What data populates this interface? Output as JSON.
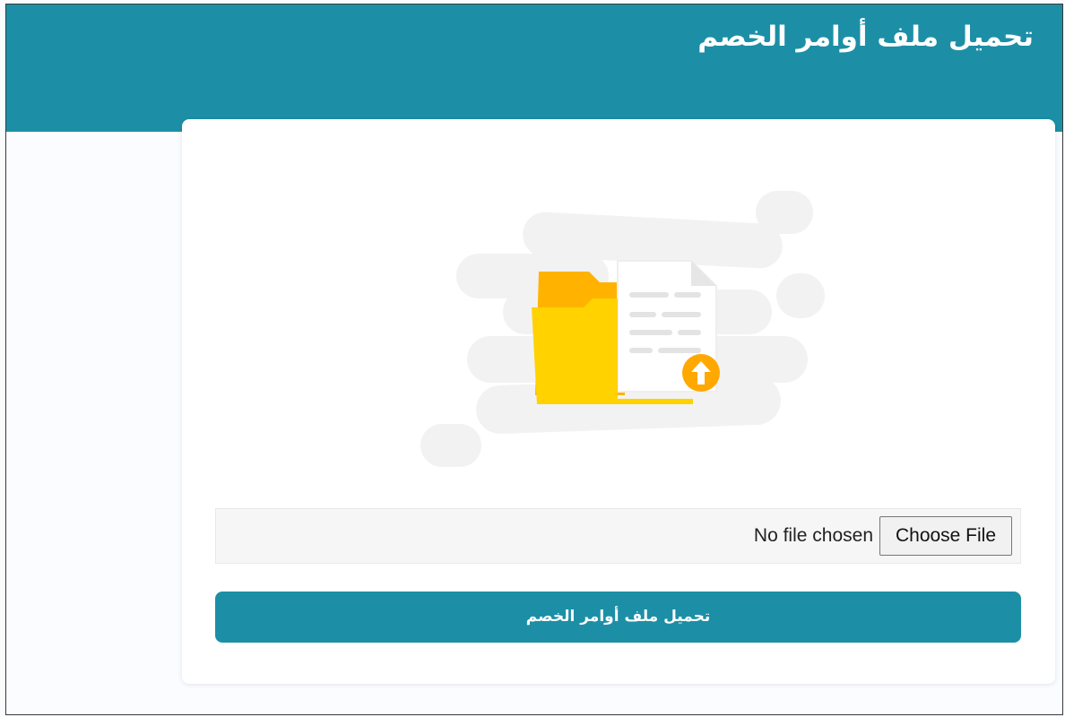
{
  "header": {
    "title": "تحميل ملف أوامر الخصم"
  },
  "upload": {
    "file_status": "No file chosen",
    "choose_label": "Choose File",
    "submit_label": "تحميل ملف أوامر الخصم"
  },
  "icons": {
    "illustration": "folder-upload-illustration",
    "upload_badge": "upload-arrow-icon"
  },
  "colors": {
    "brand": "#1c8fa6",
    "folder_front": "#ffd200",
    "folder_back": "#ffb300",
    "badge": "#ffa800"
  }
}
